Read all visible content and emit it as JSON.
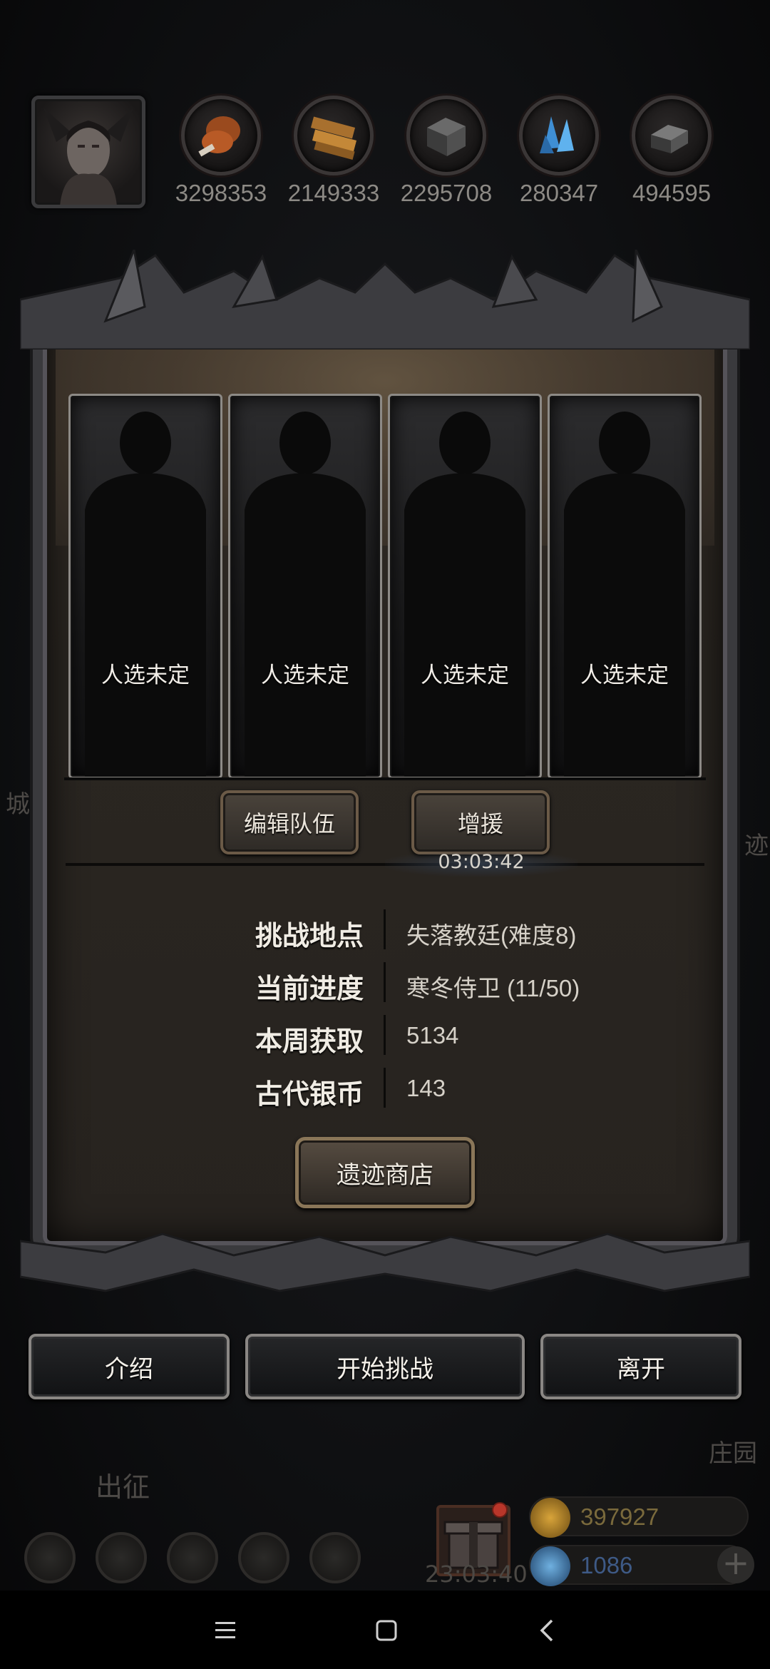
{
  "resources": [
    {
      "icon": "meat-icon",
      "value": "3298353"
    },
    {
      "icon": "wood-icon",
      "value": "2149333"
    },
    {
      "icon": "stone-icon",
      "value": "2295708"
    },
    {
      "icon": "crystal-icon",
      "value": "280347"
    },
    {
      "icon": "iron-icon",
      "value": "494595"
    }
  ],
  "slots": [
    {
      "label": "人选未定"
    },
    {
      "label": "人选未定"
    },
    {
      "label": "人选未定"
    },
    {
      "label": "人选未定"
    }
  ],
  "team_buttons": {
    "edit": "编辑队伍",
    "reinforce": "增援"
  },
  "timer": "03:03:42",
  "info": [
    {
      "key": "挑战地点",
      "value": "失落教廷(难度8)"
    },
    {
      "key": "当前进度",
      "value": "寒冬侍卫 (11/50)"
    },
    {
      "key": "本周获取",
      "value": "5134"
    },
    {
      "key": "古代银币",
      "value": "143"
    }
  ],
  "shop_button": "遗迹商店",
  "actions": {
    "intro": "介绍",
    "start": "开始挑战",
    "leave": "离开"
  },
  "hud": {
    "left_edge": "城",
    "right_edge": "迹",
    "expedition": "出征",
    "manor": "庄园",
    "gift_timer": "23:03:40",
    "gold": "397927",
    "gems": "1086"
  },
  "colors": {
    "panel": "#2a2621",
    "frame": "#3a3a3d",
    "text": "#f0ece4"
  }
}
